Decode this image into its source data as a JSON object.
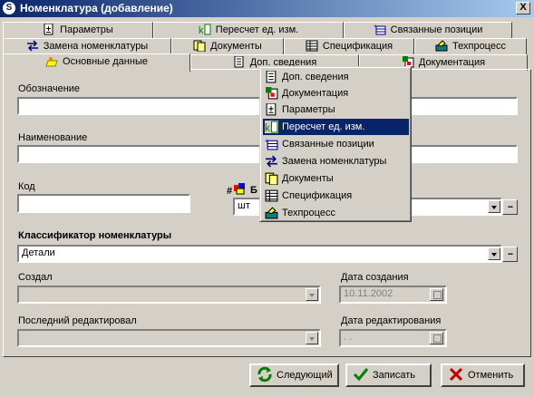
{
  "window": {
    "title": "Номенклатура (добавление)",
    "close_glyph": "X"
  },
  "tabs": {
    "row1": [
      {
        "label": "Параметры",
        "icon": "parameters-icon"
      },
      {
        "label": "Пересчет ед. изм.",
        "icon": "unit-conversion-icon"
      },
      {
        "label": "Связанные позиции",
        "icon": "linked-items-icon"
      }
    ],
    "row2": [
      {
        "label": "Замена номенклатуры",
        "icon": "replace-arrows-icon"
      },
      {
        "label": "Документы",
        "icon": "documents-icon"
      },
      {
        "label": "Спецификация",
        "icon": "specification-grid-icon"
      },
      {
        "label": "Техпроцесс",
        "icon": "techprocess-icon"
      }
    ],
    "row3": [
      {
        "label": "Основные данные",
        "icon": "main-data-icon",
        "active": true
      },
      {
        "label": "Доп. сведения",
        "icon": "extra-info-icon"
      },
      {
        "label": "Документация",
        "icon": "documentation-icon"
      }
    ]
  },
  "form": {
    "designation_label": "Обозначение",
    "designation_value": "",
    "name_label": "Наименование",
    "name_value": "",
    "code_label": "Код",
    "code_value": "",
    "unit_prefix": "#",
    "unit_label": "Б",
    "unit_value": "шт",
    "classifier_label": "Классификатор номенклатуры",
    "classifier_value": "Детали",
    "created_by_label": "Создал",
    "created_by_value": "",
    "created_date_label": "Дата создания",
    "created_date_value": "10.11.2002",
    "last_editor_label": "Последний редактировал",
    "last_editor_value": "",
    "edit_date_label": "Дата редактирования",
    "edit_date_value": " .  ."
  },
  "buttons": {
    "next_label": "Следующий",
    "save_label": "Записать",
    "cancel_label": "Отменить",
    "ellipsis": "..."
  },
  "menu": {
    "items": [
      {
        "label": "Доп. сведения",
        "icon": "extra-info-icon"
      },
      {
        "label": "Документация",
        "icon": "documentation-icon"
      },
      {
        "label": "Параметры",
        "icon": "parameters-icon"
      },
      {
        "label": "Пересчет ед. изм.",
        "icon": "unit-conversion-icon",
        "highlighted": true
      },
      {
        "label": "Связанные позиции",
        "icon": "linked-items-icon"
      },
      {
        "label": "Замена номенклатуры",
        "icon": "replace-arrows-icon"
      },
      {
        "label": "Документы",
        "icon": "documents-icon"
      },
      {
        "label": "Спецификация",
        "icon": "specification-grid-icon"
      },
      {
        "label": "Техпроцесс",
        "icon": "techprocess-icon"
      }
    ]
  },
  "colors": {
    "titlebar_start": "#0a246a",
    "titlebar_end": "#a6caf0",
    "face": "#d4d0c8",
    "menu_highlight": "#0a246a"
  }
}
